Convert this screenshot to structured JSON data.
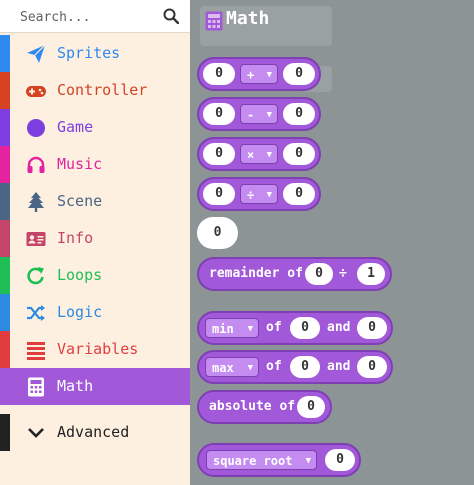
{
  "search": {
    "placeholder": "Search..."
  },
  "categories": [
    {
      "label": "Sprites",
      "color": "#2e8af0",
      "icon": "paper-plane-icon"
    },
    {
      "label": "Controller",
      "color": "#d54322",
      "icon": "gamepad-icon"
    },
    {
      "label": "Game",
      "color": "#7e3fe0",
      "icon": "circle-icon"
    },
    {
      "label": "Music",
      "color": "#e5229f",
      "icon": "headphones-icon"
    },
    {
      "label": "Scene",
      "color": "#4b6584",
      "icon": "tree-icon"
    },
    {
      "label": "Info",
      "color": "#c44569",
      "icon": "id-card-icon"
    },
    {
      "label": "Loops",
      "color": "#20bf55",
      "icon": "loop-icon"
    },
    {
      "label": "Logic",
      "color": "#2e8ae0",
      "icon": "shuffle-icon"
    },
    {
      "label": "Variables",
      "color": "#e03e3e",
      "icon": "list-icon"
    },
    {
      "label": "Math",
      "color": "#a259d9",
      "icon": "calculator-icon",
      "selected": true
    },
    {
      "label": "Advanced",
      "color": "#222222",
      "icon": "chevron-down-icon"
    }
  ],
  "flyout": {
    "title": "Math",
    "blocks": {
      "add": {
        "left": "0",
        "op": "+",
        "right": "0"
      },
      "subtract": {
        "left": "0",
        "op": "-",
        "right": "0"
      },
      "multiply": {
        "left": "0",
        "op": "×",
        "right": "0"
      },
      "divide": {
        "left": "0",
        "op": "÷",
        "right": "0"
      },
      "number": "0",
      "remainder": {
        "label": "remainder of",
        "left": "0",
        "op": "÷",
        "right": "1"
      },
      "min": {
        "op": "min",
        "of": "of",
        "left": "0",
        "and": "and",
        "right": "0"
      },
      "max": {
        "op": "max",
        "of": "of",
        "left": "0",
        "and": "and",
        "right": "0"
      },
      "absolute": {
        "label": "absolute of",
        "value": "0"
      },
      "sqrt": {
        "op": "square root",
        "value": "0"
      }
    }
  },
  "colors": {
    "math": "#a259d9",
    "math_border": "#7e3fb3",
    "sidebar_bg": "#fdf0e1",
    "workspace": "#8d9495"
  }
}
